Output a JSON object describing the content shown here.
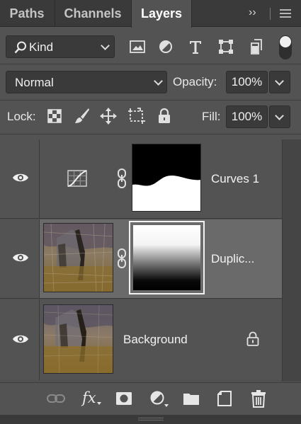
{
  "tabs": [
    {
      "label": "Paths"
    },
    {
      "label": "Channels"
    },
    {
      "label": "Layers"
    }
  ],
  "tab_controls": {
    "expand": "››",
    "menu": "≡"
  },
  "filter": {
    "label": "Kind"
  },
  "blend": {
    "mode": "Normal",
    "opacity_label": "Opacity:",
    "opacity_value": "100%"
  },
  "lock": {
    "label": "Lock:",
    "fill_label": "Fill:",
    "fill_value": "100%"
  },
  "layers": [
    {
      "name": "Curves 1",
      "type": "adjustment",
      "visible": true,
      "selected": false
    },
    {
      "name": "Duplic...",
      "type": "pixel-with-mask",
      "visible": true,
      "selected": true
    },
    {
      "name": "Background",
      "type": "background",
      "visible": true,
      "selected": false,
      "locked": true
    }
  ],
  "bottom_toolbar": {
    "fx_label": "fx"
  },
  "colors": {
    "panel": "#535353",
    "selected_layer": "#6a6a6a",
    "tabbar": "#3a3a3a",
    "field": "#3a3a3a"
  }
}
